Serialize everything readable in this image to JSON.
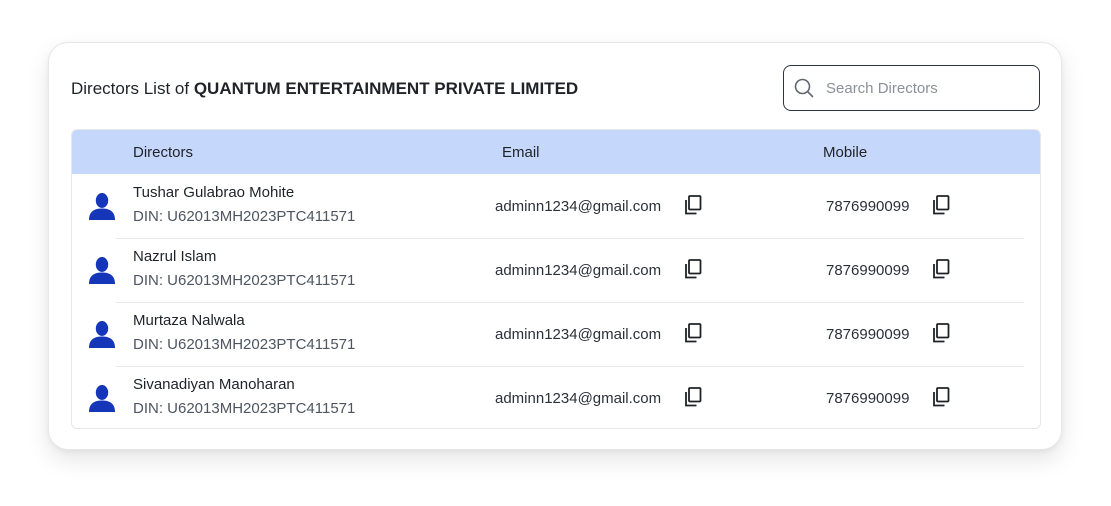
{
  "header": {
    "title_prefix": "Directors List of ",
    "company_name": "QUANTUM ENTERTAINMENT PRIVATE LIMITED"
  },
  "search": {
    "placeholder": "Search Directors",
    "value": ""
  },
  "table": {
    "columns": {
      "directors": "Directors",
      "email": "Email",
      "mobile": "Mobile"
    },
    "rows": [
      {
        "name": "Tushar Gulabrao Mohite",
        "din": "DIN: U62013MH2023PTC411571",
        "email": "adminn1234@gmail.com",
        "mobile": "7876990099"
      },
      {
        "name": "Nazrul Islam",
        "din": "DIN: U62013MH2023PTC411571",
        "email": "adminn1234@gmail.com",
        "mobile": "7876990099"
      },
      {
        "name": "Murtaza Nalwala",
        "din": "DIN: U62013MH2023PTC411571",
        "email": "adminn1234@gmail.com",
        "mobile": "7876990099"
      },
      {
        "name": "Sivanadiyan Manoharan",
        "din": "DIN: U62013MH2023PTC411571",
        "email": "adminn1234@gmail.com",
        "mobile": "7876990099"
      }
    ]
  },
  "icons": {
    "search": "search-icon",
    "avatar": "user-icon",
    "copy": "copy-icon"
  },
  "colors": {
    "header_background": "#c5d7fb",
    "avatar": "#1536b8"
  }
}
